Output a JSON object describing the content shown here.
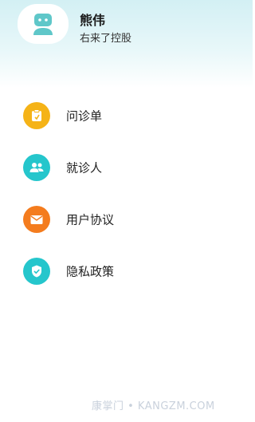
{
  "profile": {
    "name": "熊伟",
    "organization": "右来了控股",
    "avatar_icon": "user-avatar-icon"
  },
  "menu": {
    "items": [
      {
        "label": "问诊单",
        "icon": "consult-form-icon",
        "color": "#f5b317"
      },
      {
        "label": "就诊人",
        "icon": "patients-icon",
        "color": "#25c6cc"
      },
      {
        "label": "用户协议",
        "icon": "agreement-icon",
        "color": "#f47c1e"
      },
      {
        "label": "隐私政策",
        "icon": "privacy-shield-icon",
        "color": "#25c6cc"
      }
    ]
  },
  "watermark": "康掌门 • KANGZM.COM",
  "colors": {
    "header_gradient_top": "#d3f0f4",
    "avatar_teal": "#5fc7c9"
  }
}
